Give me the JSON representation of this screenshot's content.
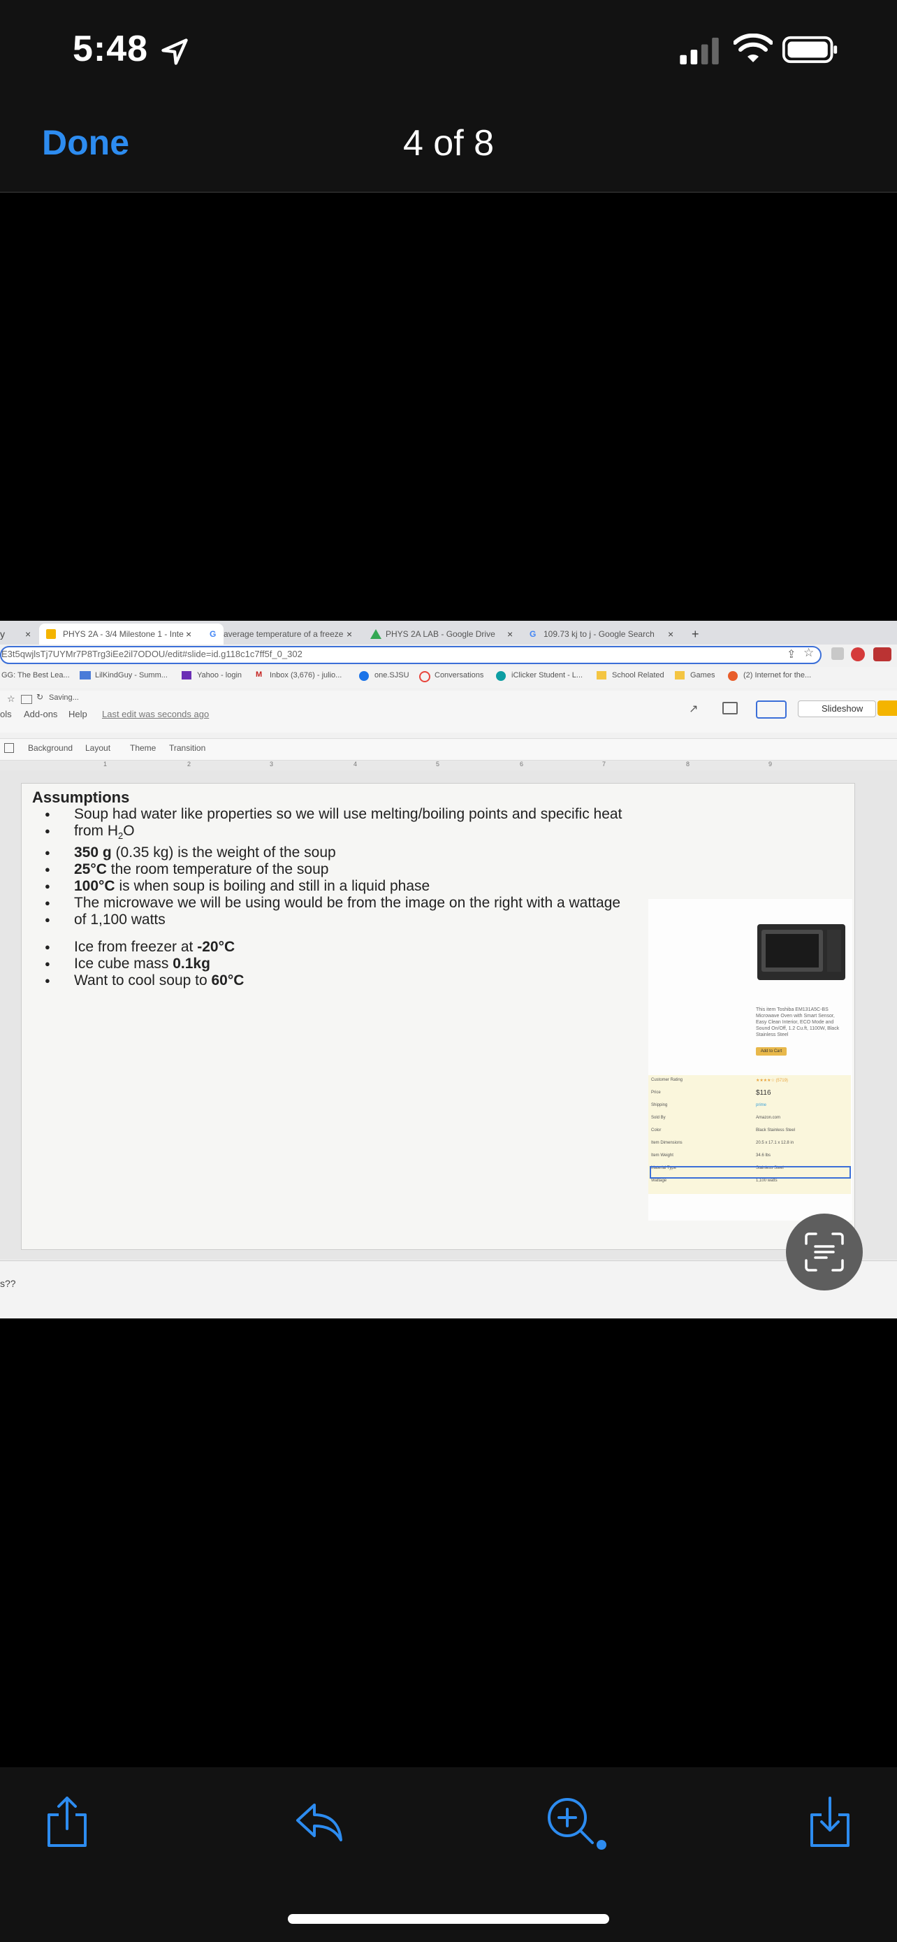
{
  "status": {
    "time": "5:48"
  },
  "nav": {
    "done_label": "Done",
    "counter": "4 of 8"
  },
  "browser": {
    "tabs": [
      {
        "title": "PHYS 2A - 3/4 Milestone 1 - Inte"
      },
      {
        "title": "average temperature of a freeze"
      },
      {
        "title": "PHYS 2A LAB - Google Drive"
      },
      {
        "title": "109.73 kj to j - Google Search"
      }
    ],
    "new_tab": "+",
    "url": "E3t5qwjlsTj7UYMr7P8Trg3iEe2il7ODOU/edit#slide=id.g118c1c7ff5f_0_302",
    "bookmarks": [
      "GG: The Best Lea...",
      "LilKindGuy - Summ...",
      "Yahoo - login",
      "Inbox (3,676) - julio...",
      "one.SJSU",
      "Conversations",
      "iClicker Student - L...",
      "School Related",
      "Games",
      "(2) Internet for the..."
    ]
  },
  "slides_app": {
    "saving": "Saving...",
    "menu": [
      "ols",
      "Add-ons",
      "Help"
    ],
    "last_edit": "Last edit was seconds ago",
    "slideshow_label": "Slideshow",
    "toolbar2": [
      "Background",
      "Layout",
      "Theme",
      "Transition"
    ],
    "ruler_ticks": [
      "1",
      "2",
      "3",
      "4",
      "5",
      "6",
      "7",
      "8",
      "9"
    ],
    "notes_text": "s??"
  },
  "slide": {
    "title": "Assumptions",
    "bullets1": [
      {
        "bold": "",
        "text": "Soup had water like properties so we will use melting/boiling points and specific heat"
      },
      {
        "bold": "",
        "text": "from H2O",
        "continuation": true
      },
      {
        "bold": "350 g",
        "text": " (0.35 kg) is the weight of the soup"
      },
      {
        "bold": "25°C",
        "text": " the room temperature of the soup"
      },
      {
        "bold": "100°C",
        "text": " is when soup is boiling and still in a liquid phase"
      },
      {
        "bold": "",
        "text": "The microwave we will be using would be from the image on the right with a wattage"
      },
      {
        "bold": "",
        "text": "of 1,100 watts",
        "continuation": true
      }
    ],
    "bullets2": [
      {
        "pre": " Ice from freezer at ",
        "bold": "-20°C"
      },
      {
        "pre": " Ice cube mass ",
        "bold": "0.1kg"
      },
      {
        "pre": "Want to cool soup to ",
        "bold": "60°C"
      }
    ],
    "product": {
      "text": "This item Toshiba EM131A5C-BS Microwave Oven with Smart Sensor, Easy Clean Interior, ECO Mode and Sound On/Off, 1.2 Cu.ft, 1100W, Black Stainless Steel",
      "add_to_cart": "Add to Cart",
      "price": "$116",
      "spec_labels": [
        "Customer Rating",
        "Price",
        "Shipping",
        "Sold By",
        "Color",
        "Item Dimensions",
        "Item Weight",
        "Material Type",
        "Wattage"
      ],
      "spec_values": [
        "★★★★☆ (5719)",
        "$116.99",
        "prime",
        "Amazon.com",
        "Black Stainless Steel",
        "20.5 x 17.1 x 12.8 in",
        "34.6 lbs",
        "Stainless Steel",
        "1,100 watts"
      ]
    }
  }
}
